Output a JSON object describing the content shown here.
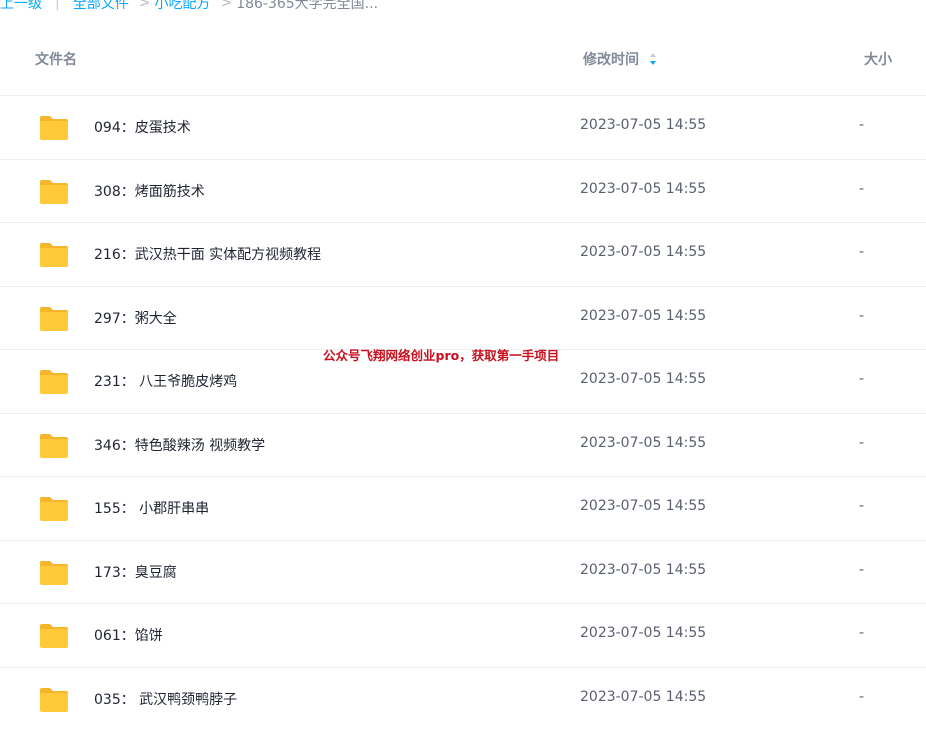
{
  "breadcrumb": {
    "back": "上一级",
    "items": [
      "全部文件",
      "小吃配方"
    ],
    "separator": ">",
    "current": "186-365大学完全国..."
  },
  "header": {
    "name": "文件名",
    "modified": "修改时间",
    "size": "大小"
  },
  "files": [
    {
      "name": "094：皮蛋技术",
      "modified": "2023-07-05 14:55",
      "size": "-"
    },
    {
      "name": "308：烤面筋技术",
      "modified": "2023-07-05 14:55",
      "size": "-"
    },
    {
      "name": "216：武汉热干面 实体配方视频教程",
      "modified": "2023-07-05 14:55",
      "size": "-"
    },
    {
      "name": "297：粥大全",
      "modified": "2023-07-05 14:55",
      "size": "-"
    },
    {
      "name": "231： 八王爷脆皮烤鸡",
      "modified": "2023-07-05 14:55",
      "size": "-"
    },
    {
      "name": "346：特色酸辣汤 视频教学",
      "modified": "2023-07-05 14:55",
      "size": "-"
    },
    {
      "name": "155： 小郡肝串串",
      "modified": "2023-07-05 14:55",
      "size": "-"
    },
    {
      "name": "173：臭豆腐",
      "modified": "2023-07-05 14:55",
      "size": "-"
    },
    {
      "name": "061：馅饼",
      "modified": "2023-07-05 14:55",
      "size": "-"
    },
    {
      "name": "035： 武汉鸭颈鸭脖子",
      "modified": "2023-07-05 14:55",
      "size": "-"
    }
  ],
  "watermark": "公众号飞翔网络创业pro，获取第一手项目",
  "colors": {
    "accent": "#06a7ff",
    "folder": "#ffc93a",
    "watermark": "#c8101e"
  },
  "icons": {
    "folder": "folder-icon",
    "sort": "sort-icon"
  }
}
